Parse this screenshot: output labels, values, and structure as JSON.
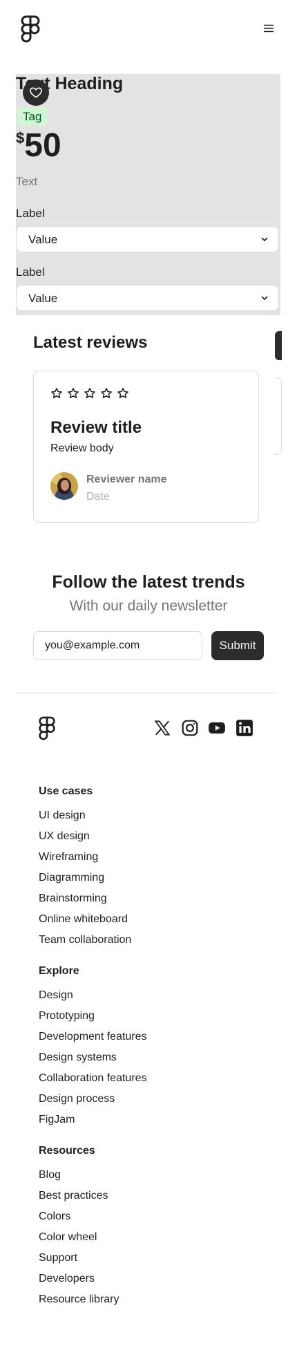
{
  "header": {
    "logo": "figma-logo",
    "menu_icon": "hamburger-menu-icon"
  },
  "product": {
    "title": "Text Heading",
    "tag": "Tag",
    "currency": "$",
    "price": "50",
    "text": "Text",
    "fields": [
      {
        "label": "Label",
        "value": "Value"
      },
      {
        "label": "Label",
        "value": "Value"
      }
    ]
  },
  "reviews": {
    "heading": "Latest reviews",
    "card": {
      "rating": 0,
      "max_rating": 5,
      "title": "Review title",
      "body": "Review body",
      "reviewer": "Reviewer name",
      "date": "Date"
    }
  },
  "newsletter": {
    "title": "Follow the latest trends",
    "subtitle": "With our daily newsletter",
    "email_value": "you@example.com",
    "submit_label": "Submit"
  },
  "footer": {
    "social_icons": [
      "x-icon",
      "instagram-icon",
      "youtube-icon",
      "linkedin-icon"
    ],
    "columns": [
      {
        "title": "Use cases",
        "links": [
          "UI design",
          "UX design",
          "Wireframing",
          "Diagramming",
          "Brainstorming",
          "Online whiteboard",
          "Team collaboration"
        ]
      },
      {
        "title": "Explore",
        "links": [
          "Design",
          "Prototyping",
          "Development features",
          "Design systems",
          "Collaboration features",
          "Design process",
          "FigJam"
        ]
      },
      {
        "title": "Resources",
        "links": [
          "Blog",
          "Best practices",
          "Colors",
          "Color wheel",
          "Support",
          "Developers",
          "Resource library"
        ]
      }
    ]
  }
}
